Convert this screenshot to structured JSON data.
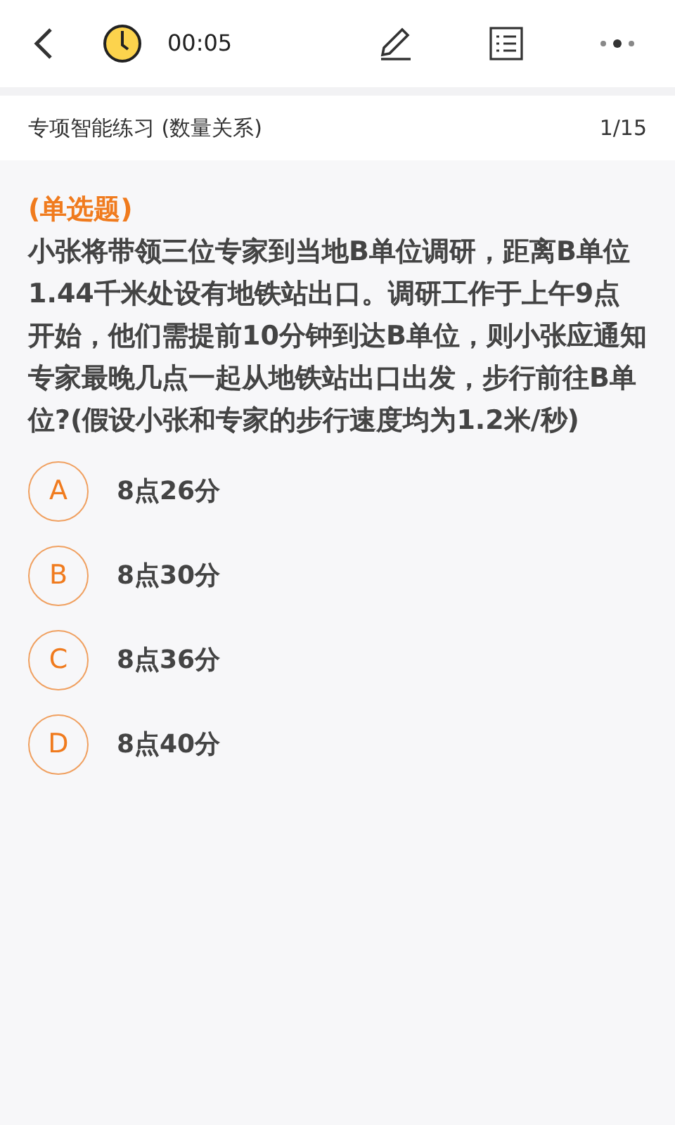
{
  "toolbar": {
    "timer": "00:05"
  },
  "section": {
    "title": "专项智能练习 (数量关系)",
    "progress": "1/15"
  },
  "question": {
    "type": "(单选题)",
    "text": "小张将带领三位专家到当地B单位调研，距离B单位1.44千米处设有地铁站出口。调研工作于上午9点开始，他们需提前10分钟到达B单位，则小张应通知专家最晚几点一起从地铁站出口出发，步行前往B单位?(假设小张和专家的步行速度均为1.2米/秒)"
  },
  "options": [
    {
      "letter": "A",
      "text": "8点26分"
    },
    {
      "letter": "B",
      "text": "8点30分"
    },
    {
      "letter": "C",
      "text": "8点36分"
    },
    {
      "letter": "D",
      "text": "8点40分"
    }
  ]
}
